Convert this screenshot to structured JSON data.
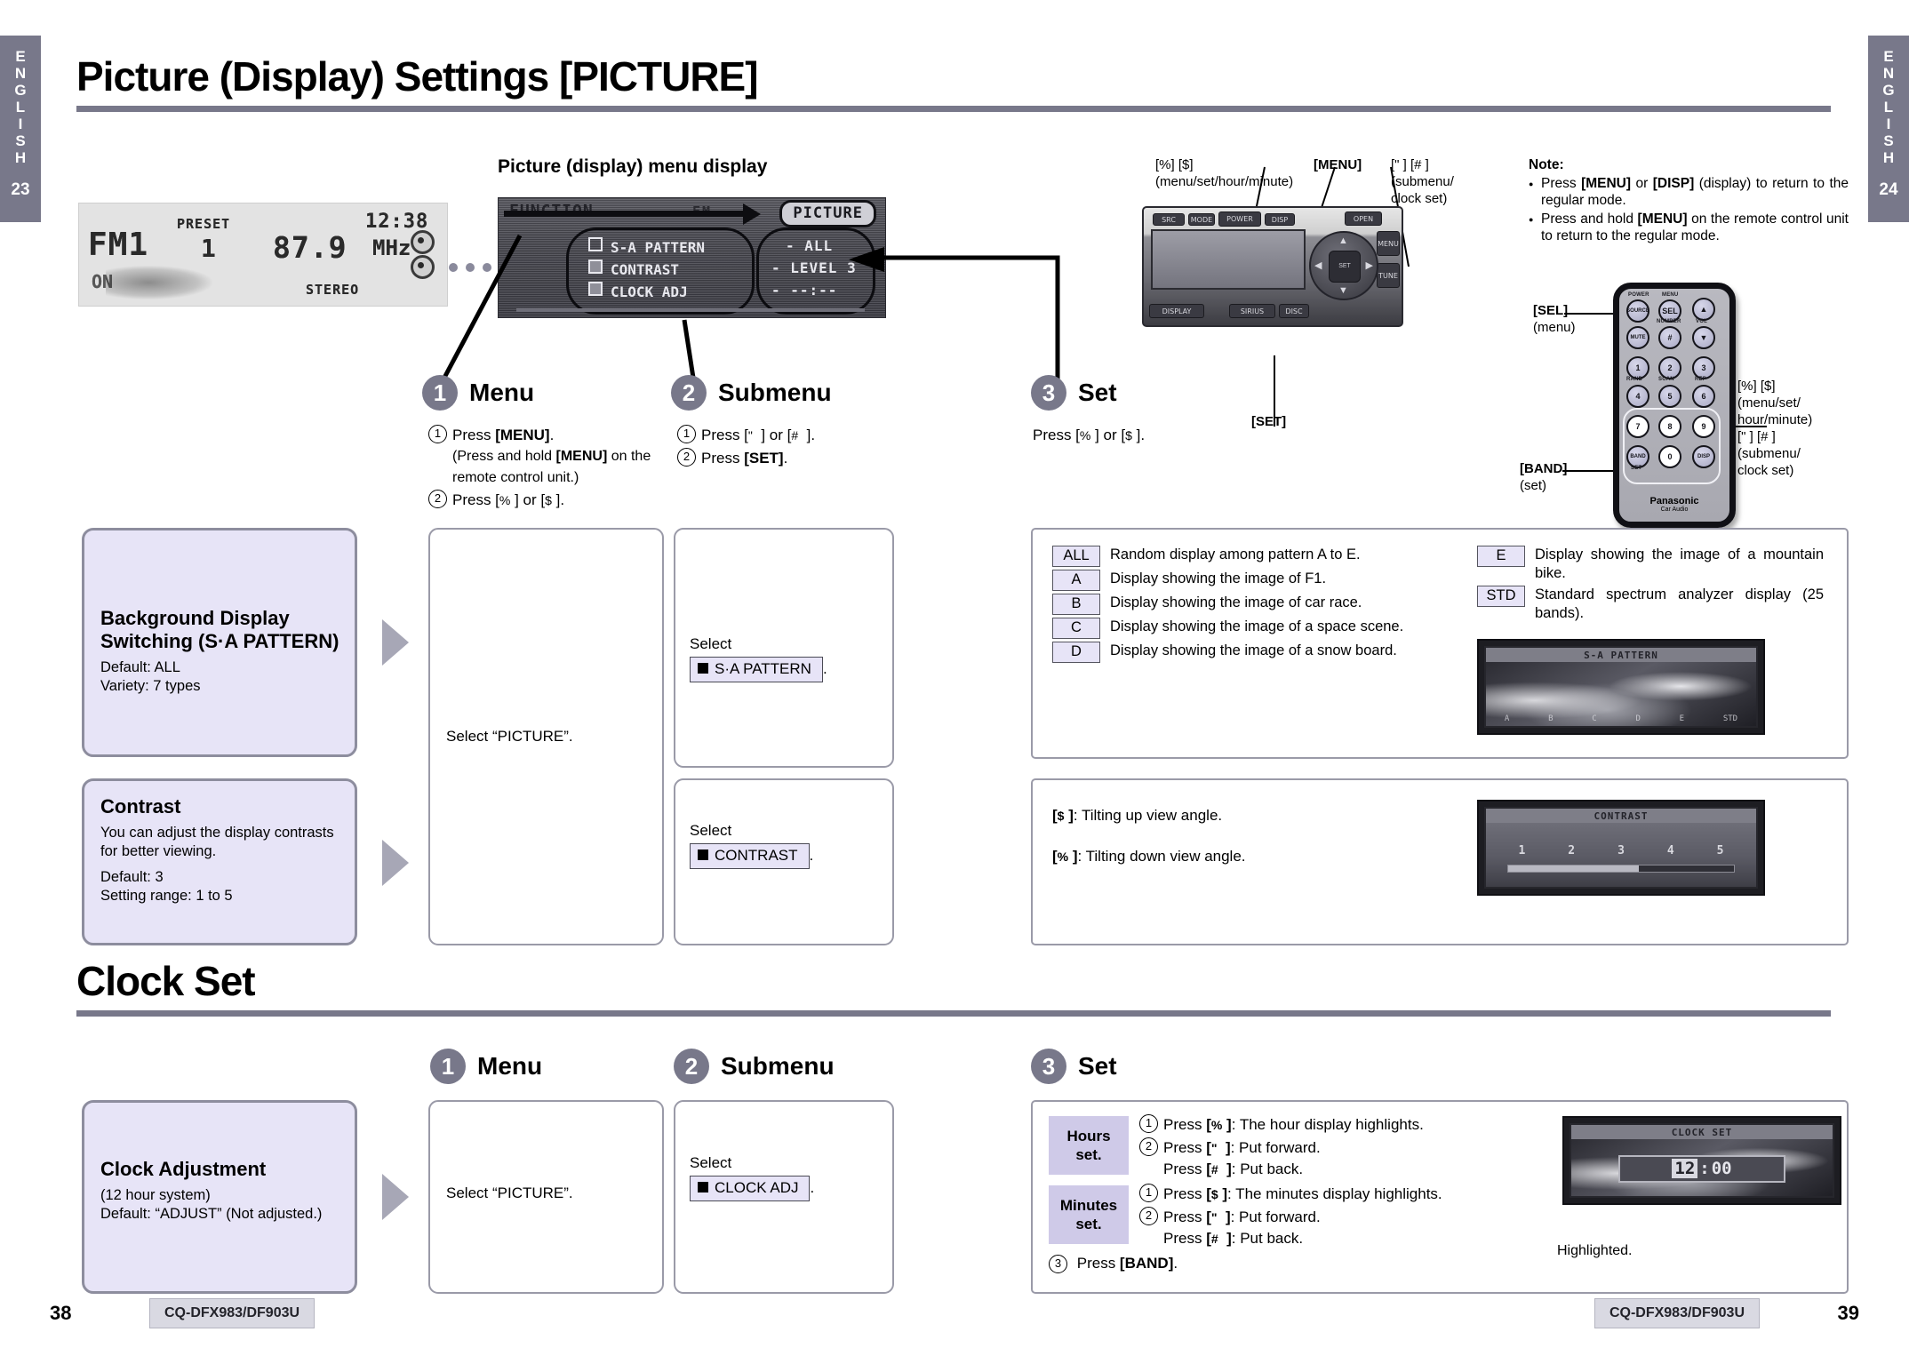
{
  "side_tabs": {
    "left": {
      "letters": "ENGLISH",
      "page": "23"
    },
    "right": {
      "letters": "ENGLISH",
      "page": "24"
    }
  },
  "headings": {
    "picture": "Picture (Display) Settings [PICTURE]",
    "clock": "Clock Set"
  },
  "lcd_display": {
    "band": "FM1",
    "preset_label": "PRESET",
    "preset_number": "1",
    "frequency": "87.9",
    "unit": "MHz",
    "time": "12:38",
    "on_indicator": "ON",
    "stereo": "STEREO"
  },
  "menu_display": {
    "caption": "Picture (display) menu display",
    "function_label": "FUNCTION",
    "source_label": "FM",
    "picture_tab": "PICTURE",
    "items": [
      {
        "label": "S-A PATTERN",
        "value": "- ALL",
        "filled": false
      },
      {
        "label": "CONTRAST",
        "value": "- LEVEL 3",
        "filled": true
      },
      {
        "label": "CLOCK ADJ",
        "value": "- --:--",
        "filled": true
      }
    ]
  },
  "unit_callouts": {
    "left_top": {
      "keys": "[%] [$]",
      "desc": "(menu/set/hour/minute)"
    },
    "menu": "[MENU]",
    "right_top": {
      "keys": "[\" ] [# ]",
      "desc": "(submenu/ clock set)"
    },
    "set": "[SET]"
  },
  "note": {
    "title": "Note:",
    "items": [
      "Press [MENU] or [DISP] (display) to return to the regular mode.",
      "Press and hold [MENU] on the remote control unit to return to the regular mode."
    ]
  },
  "remote": {
    "brand": "Panasonic",
    "sub_brand": "Car Audio",
    "labels": {
      "power": "POWER",
      "menu": "MENU",
      "number": "NUMBER",
      "vol": "VOL",
      "rand": "RAND",
      "scan": "SCAN",
      "rep": "REP",
      "set": "SET"
    },
    "keys": {
      "source": "SOURCE",
      "sel": "SEL",
      "mute": "MUTE",
      "hash": "#",
      "band": "BAND",
      "disp": "DISP",
      "numbers": [
        "1",
        "2",
        "3",
        "4",
        "5",
        "6",
        "7",
        "8",
        "9",
        "0"
      ]
    },
    "callouts": {
      "sel": {
        "key": "[SEL]",
        "desc": "(menu)"
      },
      "band": {
        "key": "[BAND]",
        "desc": "(set)"
      },
      "right": {
        "line1": "[%] [$]",
        "line2": "(menu/set/",
        "line3": "hour/minute)",
        "line4": "[\"  ] [#  ]",
        "line5": "(submenu/",
        "line6": "clock set)"
      }
    }
  },
  "steps": {
    "menu": {
      "number": "1",
      "label": "Menu",
      "sub": [
        {
          "n": "①",
          "text_a": "Press ",
          "bold": "[MENU]",
          "text_b": "."
        },
        {
          "n": "",
          "text_a": "(Press and hold ",
          "bold": "[MENU]",
          "text_b": " on the remote control unit.)"
        },
        {
          "n": "②",
          "text_a": "Press [% ] or [$ ].",
          "bold": "",
          "text_b": ""
        }
      ]
    },
    "submenu": {
      "number": "2",
      "label": "Submenu",
      "sub": [
        {
          "n": "①",
          "text_a": "Press [\"  ] or [#  ].",
          "bold": "",
          "text_b": ""
        },
        {
          "n": "②",
          "text_a": "Press ",
          "bold": "[SET]",
          "text_b": "."
        }
      ]
    },
    "set": {
      "number": "3",
      "label": "Set",
      "text": "Press [% ] or [$ ]."
    },
    "clock_menu": {
      "number": "1",
      "label": "Menu"
    },
    "clock_submenu": {
      "number": "2",
      "label": "Submenu"
    },
    "clock_set": {
      "number": "3",
      "label": "Set"
    }
  },
  "boxes": {
    "sa_pattern": {
      "title": "Background Display Switching (S·A PATTERN)",
      "line1": "Default: ALL",
      "line2": "Variety: 7 types"
    },
    "contrast": {
      "title": "Contrast",
      "desc": "You can adjust the display contrasts for better viewing.",
      "line1": "Default: 3",
      "line2": "Setting range: 1 to 5"
    },
    "clock": {
      "title": "Clock Adjustment",
      "line1": "(12 hour system)",
      "line2": "Default: “ADJUST” (Not adjusted.)"
    }
  },
  "panels": {
    "select_picture": "Select “PICTURE”.",
    "select_label": "Select",
    "sa_pattern_chip": "S·A PATTERN",
    "contrast_chip": "CONTRAST",
    "clock_chip": "CLOCK ADJ",
    "period": "."
  },
  "sa_spec": {
    "rows": [
      {
        "code": "ALL",
        "desc": "Random display among pattern A to E."
      },
      {
        "code": "A",
        "desc": "Display showing the image of F1."
      },
      {
        "code": "B",
        "desc": "Display showing the image of car race."
      },
      {
        "code": "C",
        "desc": "Display showing the image of a space scene."
      },
      {
        "code": "D",
        "desc": "Display showing the image of a snow board."
      }
    ],
    "rows_right": [
      {
        "code": "E",
        "desc": "Display showing the image of a mountain bike."
      },
      {
        "code": "STD",
        "desc": "Standard spectrum analyzer display (25 bands)."
      }
    ],
    "thumb_title": "S-A PATTERN",
    "thumb_foot": [
      "A",
      "B",
      "C",
      "D",
      "E",
      "STD"
    ]
  },
  "contrast_spec": {
    "line1": "[$ ]: Tilting up view angle.",
    "line2": "[% ]: Tilting down view angle.",
    "thumb_title": "CONTRAST",
    "scale": [
      "1",
      "2",
      "3",
      "4",
      "5"
    ]
  },
  "clock_spec": {
    "hours": {
      "label_line1": "Hours",
      "label_line2": "set.",
      "rows": [
        {
          "n": "①",
          "text_a": "Press ",
          "bold": "[% ]",
          "text_b": ": The hour display highlights."
        },
        {
          "n": "②",
          "text_a": "Press ",
          "bold": "[\"  ]",
          "text_b": ": Put forward."
        },
        {
          "n": "",
          "text_a": "Press ",
          "bold": "[#  ]",
          "text_b": ": Put back."
        }
      ]
    },
    "minutes": {
      "label_line1": "Minutes",
      "label_line2": "set.",
      "rows": [
        {
          "n": "①",
          "text_a": "Press ",
          "bold": "[$ ]",
          "text_b": ": The minutes display highlights."
        },
        {
          "n": "②",
          "text_a": "Press ",
          "bold": "[\"  ]",
          "text_b": ": Put forward."
        },
        {
          "n": "",
          "text_a": "Press ",
          "bold": "[#  ]",
          "text_b": ": Put back."
        }
      ]
    },
    "final": {
      "n": "③",
      "text_a": "Press ",
      "bold": "[BAND]",
      "text_b": "."
    },
    "thumb_title": "CLOCK SET",
    "clock_hours": "12",
    "clock_sep": ":",
    "clock_minutes": "00",
    "highlight_caption": "Highlighted."
  },
  "footer": {
    "left_page": "38",
    "right_page": "39",
    "model": "CQ-DFX983/DF903U"
  }
}
